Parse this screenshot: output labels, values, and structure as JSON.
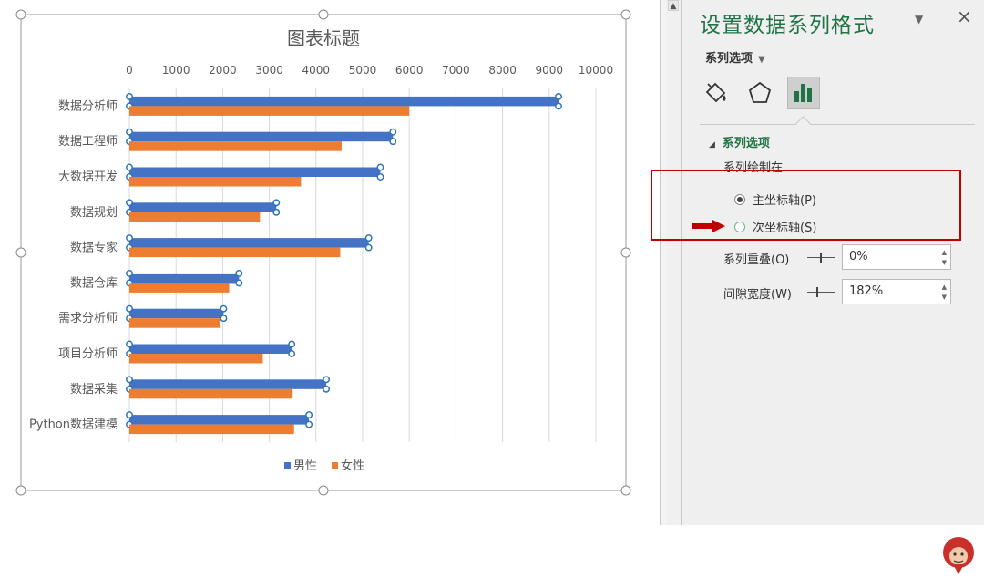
{
  "chart": {
    "chart_data": {
      "type": "bar",
      "orientation": "horizontal",
      "title": "图表标题",
      "categories": [
        "数据分析师",
        "数据工程师",
        "大数据开发",
        "数据规划",
        "数据专家",
        "数据仓库",
        "需求分析师",
        "项目分析师",
        "数据采集",
        "Python数据建模"
      ],
      "series": [
        {
          "name": "男性",
          "color": "#4472C4",
          "values": [
            9200,
            5650,
            5380,
            3150,
            5130,
            2350,
            2020,
            3480,
            4220,
            3850
          ]
        },
        {
          "name": "女性",
          "color": "#ED7D31",
          "values": [
            6000,
            4550,
            3680,
            2800,
            4520,
            2140,
            1950,
            2860,
            3500,
            3530
          ]
        }
      ],
      "x_ticks": [
        "0",
        "1000",
        "2000",
        "3000",
        "4000",
        "5000",
        "6000",
        "7000",
        "8000",
        "9000",
        "10000"
      ],
      "xlim": [
        0,
        10000
      ],
      "grid": true,
      "legend": "bottom",
      "selected_series": "男性"
    }
  },
  "pane": {
    "title": "设置数据系列格式",
    "tab_label": "系列选项",
    "section_label": "系列选项",
    "plot_on_label": "系列绘制在",
    "primary_axis_label": "主坐标轴(P)",
    "secondary_axis_label": "次坐标轴(S)",
    "primary_selected": true,
    "overlap_label": "系列重叠(O)",
    "overlap_value": "0%",
    "overlap_level": 0.5,
    "gap_label": "间隙宽度(W)",
    "gap_value": "182%",
    "gap_level": 0.36
  },
  "colors": {
    "accent": "#217346",
    "highlight_box": "#C00000",
    "series_male": "#4472C4",
    "series_female": "#ED7D31"
  },
  "icons": [
    "fill-line-icon",
    "effects-icon",
    "series-options-icon",
    "dropdown-icon",
    "close-icon",
    "arrow-right-icon",
    "monkey-logo-icon"
  ]
}
